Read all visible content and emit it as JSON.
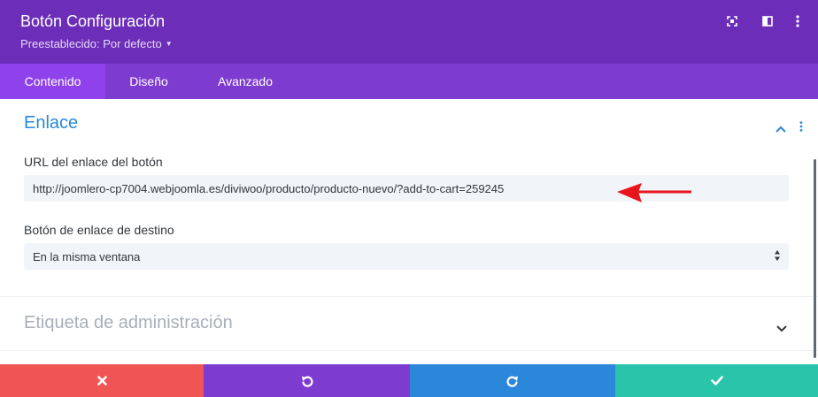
{
  "header": {
    "title": "Botón Configuración",
    "preset": "Preestablecido: Por defecto",
    "icons": [
      "expand-icon",
      "sidebar-layout-icon",
      "more-vertical-icon"
    ]
  },
  "tabs": [
    {
      "label": "Contenido",
      "active": true
    },
    {
      "label": "Diseño",
      "active": false
    },
    {
      "label": "Avanzado",
      "active": false
    }
  ],
  "sections": {
    "enlace": {
      "title": "Enlace",
      "expanded": true,
      "url_label": "URL del enlace del botón",
      "url_value": "http://joomlero-cp7004.webjoomla.es/diviwoo/producto/producto-nuevo/?add-to-cart=259245",
      "target_label": "Botón de enlace de destino",
      "target_value": "En la misma ventana"
    },
    "admin_label": {
      "title": "Etiqueta de administración",
      "expanded": false
    }
  },
  "footer": {
    "buttons": [
      "close-icon",
      "undo-icon",
      "redo-icon",
      "check-icon"
    ]
  },
  "colors": {
    "header": "#6c2eb9",
    "tabs": "#7e3bd0",
    "tab_active": "#8f42ec",
    "accent": "#2b87da",
    "cancel": "#ef5555",
    "undo": "#7e3bd0",
    "redo": "#2b87da",
    "save": "#29c4a9",
    "annotation_arrow": "#e8161c"
  }
}
